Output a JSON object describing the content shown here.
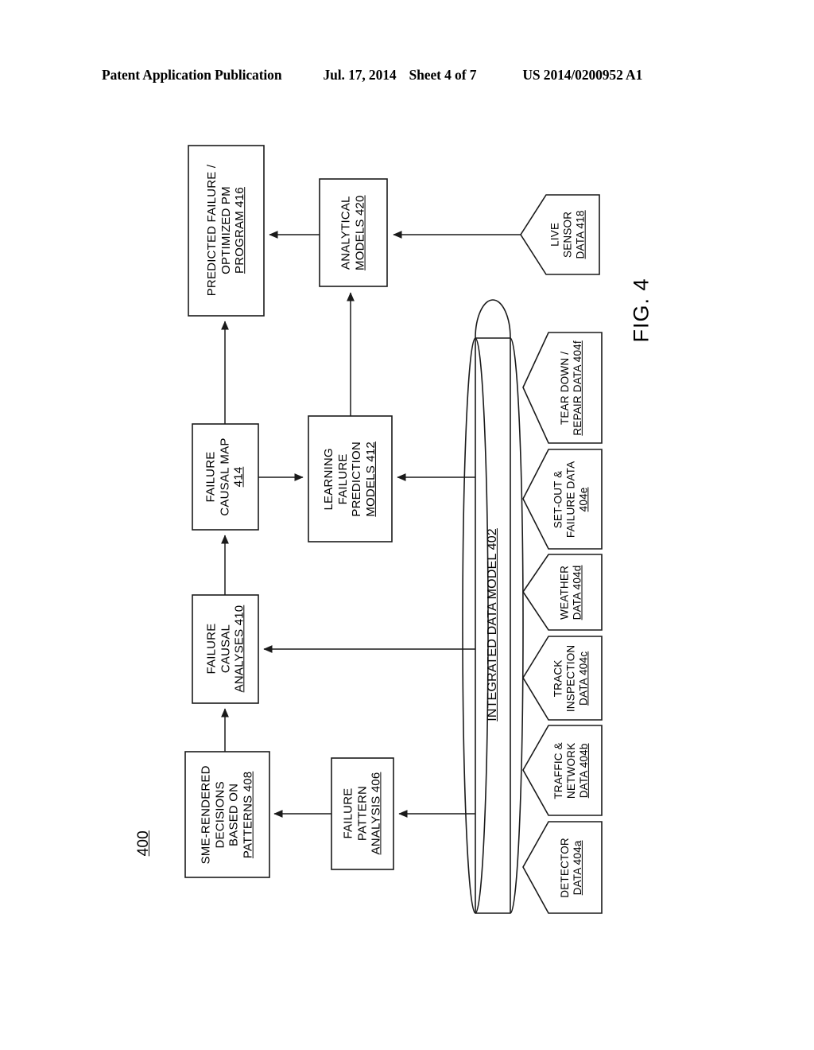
{
  "header": {
    "title": "Patent Application Publication",
    "date": "Jul. 17, 2014",
    "sheet": "Sheet 4 of 7",
    "publication_number": "US 2014/0200952 A1"
  },
  "figure": {
    "label": "FIG. 4",
    "reference_numeral": "400"
  },
  "nodes": {
    "predicted_failure": {
      "ref": "416",
      "lines": [
        "PREDICTED FAILURE /",
        "OPTIMIZED PM",
        "PROGRAM 416"
      ],
      "shape": "rectangle"
    },
    "analytical_models": {
      "ref": "420",
      "lines": [
        "ANALYTICAL",
        "MODELS 420"
      ],
      "shape": "rectangle"
    },
    "live_sensor_data": {
      "ref": "418",
      "lines": [
        "LIVE",
        "SENSOR",
        "DATA 418"
      ],
      "shape": "pentagon"
    },
    "failure_causal_map": {
      "ref": "414",
      "lines": [
        "FAILURE",
        "CAUSAL MAP",
        "414"
      ],
      "shape": "rectangle"
    },
    "learning_failure_prediction_models": {
      "ref": "412",
      "lines": [
        "LEARNING",
        "FAILURE",
        "PREDICTION",
        "MODELS 412"
      ],
      "shape": "rectangle"
    },
    "failure_causal_analyses": {
      "ref": "410",
      "lines": [
        "FAILURE",
        "CAUSAL",
        "ANALYSES 410"
      ],
      "shape": "rectangle"
    },
    "sme_rendered_decisions": {
      "ref": "408",
      "lines": [
        "SME-RENDERED",
        "DECISIONS",
        "BASED ON",
        "PATTERNS 408"
      ],
      "shape": "rectangle"
    },
    "failure_pattern_analysis": {
      "ref": "406",
      "lines": [
        "FAILURE",
        "PATTERN",
        "ANALYSIS 406"
      ],
      "shape": "rectangle"
    },
    "integrated_data_model": {
      "ref": "402",
      "lines": [
        "INTEGRATED DATA MODEL 402"
      ],
      "shape": "cylinder"
    }
  },
  "data_sources": [
    {
      "ref": "404a",
      "lines": [
        "DETECTOR",
        "DATA 404a"
      ]
    },
    {
      "ref": "404b",
      "lines": [
        "TRAFFIC &",
        "NETWORK",
        "DATA 404b"
      ]
    },
    {
      "ref": "404c",
      "lines": [
        "TRACK",
        "INSPECTION",
        "DATA 404c"
      ]
    },
    {
      "ref": "404d",
      "lines": [
        "WEATHER",
        "DATA 404d"
      ]
    },
    {
      "ref": "404e",
      "lines": [
        "SET-OUT &",
        "FAILURE DATA",
        "404e"
      ]
    },
    {
      "ref": "404f",
      "lines": [
        "TEAR DOWN /",
        "REPAIR DATA 404f"
      ]
    }
  ],
  "style": {
    "stroke": "#1a1a1a",
    "background": "#ffffff"
  }
}
